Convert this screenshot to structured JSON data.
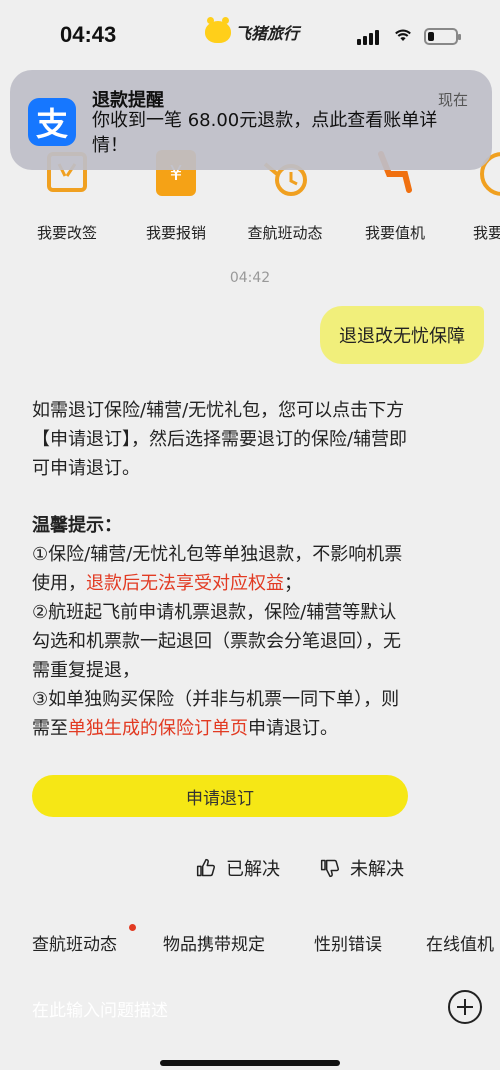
{
  "status_bar": {
    "time": "04:43",
    "app_brand": "飞猪旅行"
  },
  "notification": {
    "app_icon": "alipay-icon",
    "app_icon_glyph": "支",
    "title": "退款提醒",
    "time": "现在",
    "body": "你收到一笔 68.00元退款，点此查看账单详情！"
  },
  "quick_actions": [
    {
      "label": "我要改签",
      "icon": "change-ticket-icon"
    },
    {
      "label": "我要报销",
      "icon": "reimburse-icon"
    },
    {
      "label": "查航班动态",
      "icon": "flight-status-icon"
    },
    {
      "label": "我要值机",
      "icon": "checkin-icon"
    },
    {
      "label": "我要",
      "icon": "more-icon"
    }
  ],
  "chat": {
    "timestamp": "04:42",
    "user_message": "退退改无忧保障",
    "bot_message": {
      "para1": "如需退订保险/辅营/无忧礼包，您可以点击下方【申请退订】，然后选择需要退订的保险/辅营即可申请退订。",
      "tips_title": "温馨提示：",
      "tip1_prefix": "①保险/辅营/无忧礼包等单独退款，不影响机票使用，",
      "tip1_red": "退款后无法享受对应权益",
      "tip1_suffix": "；",
      "tip2": "②航班起飞前申请机票退款，保险/辅营等默认勾选和机票款一起退回（票款会分笔退回），无需重复提退，",
      "tip3_prefix": "③如单独购买保险（并非与机票一同下单），则需至",
      "tip3_red": "单独生成的保险订单页",
      "tip3_suffix": "申请退订。"
    },
    "apply_button": "申请退订",
    "resolved": "已解决",
    "unresolved": "未解决"
  },
  "tabs": [
    "查航班动态",
    "物品携带规定",
    "性别错误",
    "在线值机"
  ],
  "input": {
    "placeholder": "在此输入问题描述"
  },
  "colors": {
    "accent_yellow": "#f6e715",
    "user_bubble": "#f1ef7b",
    "warning_red": "#e23a22",
    "alipay_blue": "#1677ff"
  }
}
